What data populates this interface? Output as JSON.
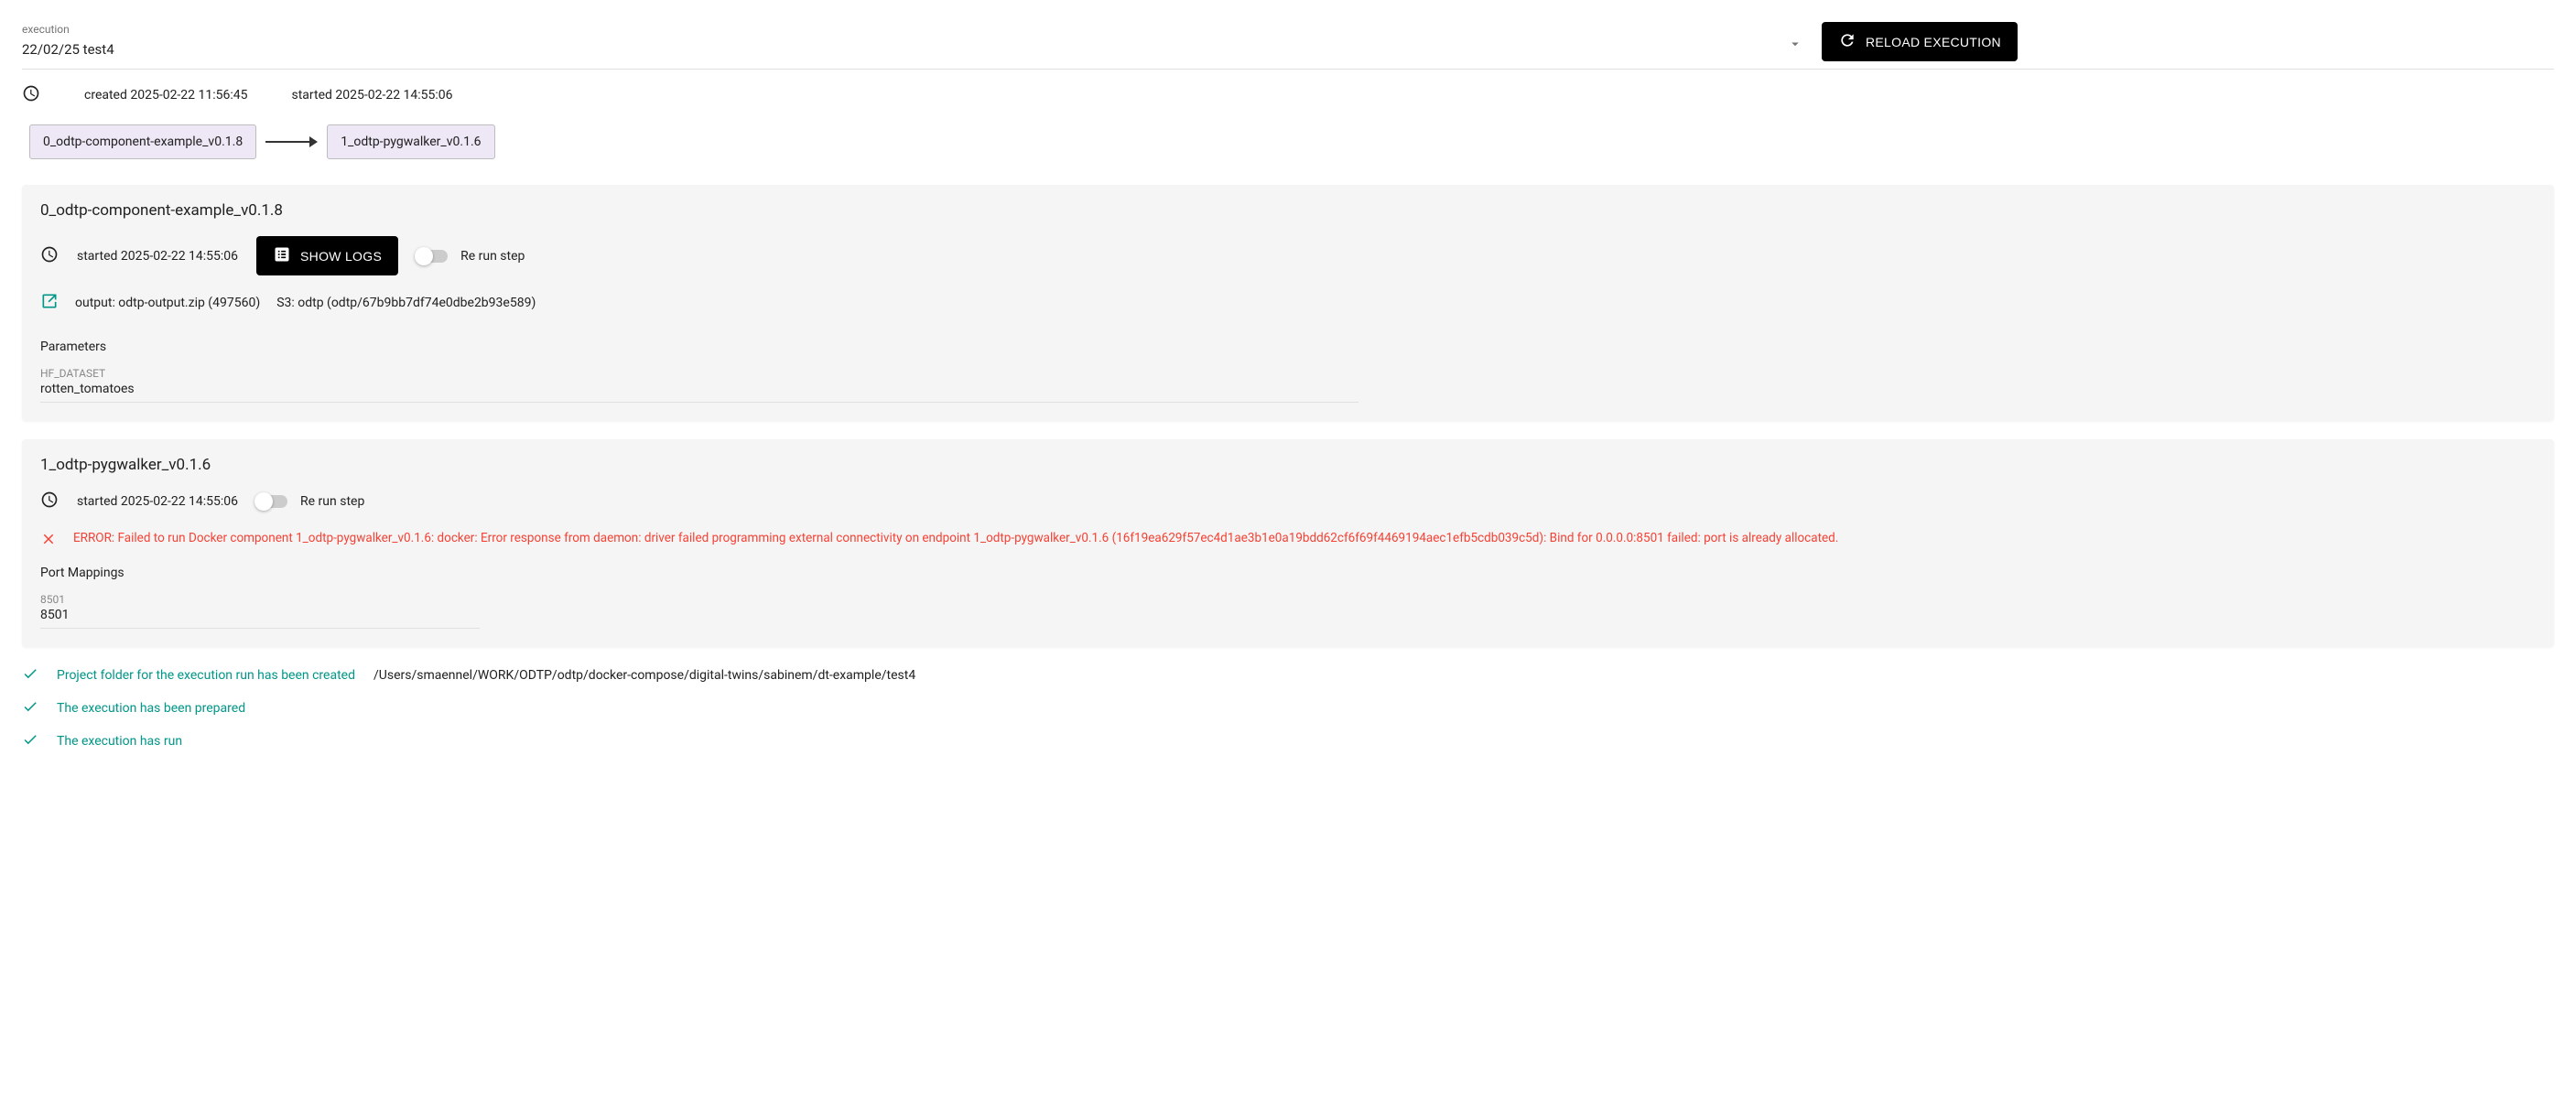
{
  "header": {
    "select_label": "execution",
    "select_value": "22/02/25 test4",
    "reload_label": "RELOAD EXECUTION"
  },
  "meta": {
    "created": "created 2025-02-22 11:56:45",
    "started": "started 2025-02-22 14:55:06"
  },
  "flow": {
    "node0": "0_odtp-component-example_v0.1.8",
    "node1": "1_odtp-pygwalker_v0.1.6"
  },
  "step0": {
    "title": "0_odtp-component-example_v0.1.8",
    "started": "started 2025-02-22 14:55:06",
    "show_logs_label": "SHOW LOGS",
    "rerun_label": "Re run step",
    "output_text": "output: odtp-output.zip (497560)",
    "s3_text": "S3: odtp (odtp/67b9bb7df74e0dbe2b93e589)",
    "params_label": "Parameters",
    "param0": {
      "label": "HF_DATASET",
      "value": "rotten_tomatoes"
    }
  },
  "step1": {
    "title": "1_odtp-pygwalker_v0.1.6",
    "started": "started 2025-02-22 14:55:06",
    "rerun_label": "Re run step",
    "error_text": "ERROR: Failed to run Docker component 1_odtp-pygwalker_v0.1.6: docker: Error response from daemon: driver failed programming external connectivity on endpoint 1_odtp-pygwalker_v0.1.6 (16f19ea629f57ec4d1ae3b1e0a19bdd62cf6f69f4469194aec1efb5cdb039c5d): Bind for 0.0.0.0:8501 failed: port is already allocated.",
    "ports_label": "Port Mappings",
    "port0": {
      "label": "8501",
      "value": "8501"
    }
  },
  "status": {
    "s0_msg": "Project folder for the execution run has been created",
    "s0_path": "/Users/smaennel/WORK/ODTP/odtp/docker-compose/digital-twins/sabinem/dt-example/test4",
    "s1_msg": "The execution has been prepared",
    "s2_msg": "The execution has run"
  }
}
